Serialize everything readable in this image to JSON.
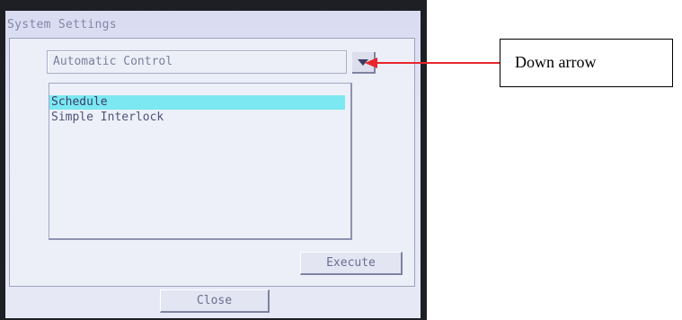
{
  "window": {
    "title": "System Settings"
  },
  "dropdown": {
    "selected_value": "Automatic Control",
    "arrow_icon": "chevron-down-icon"
  },
  "list": {
    "items": [
      {
        "label": "Schedule",
        "selected": true
      },
      {
        "label": "Simple Interlock",
        "selected": false
      }
    ]
  },
  "buttons": {
    "execute_label": "Execute",
    "close_label": "Close"
  },
  "annotation": {
    "label": "Down arrow",
    "arrow_color": "#e8262c"
  },
  "colors": {
    "selection_highlight": "#7be8f2",
    "screen_background": "#e4e6f5"
  }
}
